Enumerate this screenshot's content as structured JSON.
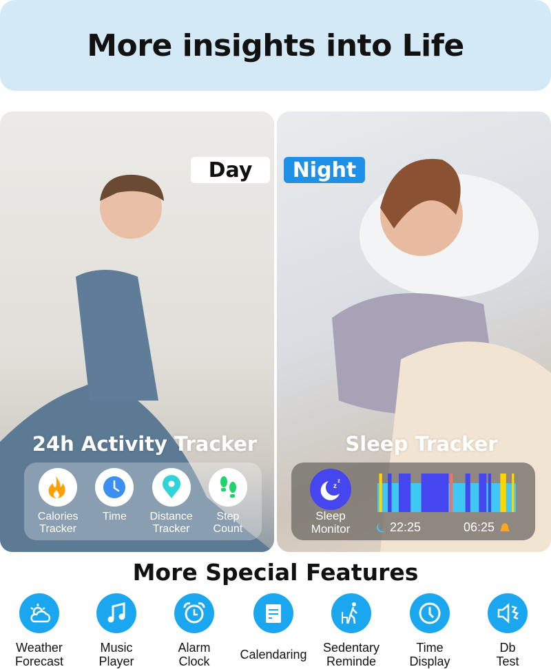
{
  "header": {
    "title": "More insights into Life"
  },
  "day": {
    "tag": "Day",
    "title": "24h Activity Tracker",
    "items": [
      {
        "label1": "Calories",
        "label2": "Tracker",
        "icon": "flame-icon",
        "color": "#ff9f00"
      },
      {
        "label1": "Time",
        "label2": "",
        "icon": "clock-icon",
        "color": "#3b8ff0"
      },
      {
        "label1": "Distance",
        "label2": "Tracker",
        "icon": "location-pin-icon",
        "color": "#2fd3d8"
      },
      {
        "label1": "Step",
        "label2": "Count",
        "icon": "footprints-icon",
        "color": "#1ed36a"
      }
    ]
  },
  "night": {
    "tag": "Night",
    "title": "Sleep Tracker",
    "monitor1": "Sleep",
    "monitor2": "Monitor",
    "start": "22:25",
    "end": "06:25",
    "colors": {
      "light": "#3fc8f5",
      "deep": "#4646f0",
      "awake": "#ffd600",
      "rem": "#f0706a"
    },
    "segments": [
      {
        "stage": "awake",
        "from": "22:31",
        "to": "22:41"
      },
      {
        "stage": "deep",
        "from": "23:01",
        "to": "23:14"
      },
      {
        "stage": "deep",
        "from": "23:39",
        "to": "00:20"
      },
      {
        "stage": "deep",
        "from": "00:57",
        "to": "02:32"
      },
      {
        "stage": "rem",
        "from": "02:36",
        "to": "02:46"
      },
      {
        "stage": "deep",
        "from": "03:30",
        "to": "03:47"
      },
      {
        "stage": "deep",
        "from": "04:17",
        "to": "04:43"
      },
      {
        "stage": "deep",
        "from": "04:49",
        "to": "04:59"
      },
      {
        "stage": "awake",
        "from": "05:31",
        "to": "05:51"
      },
      {
        "stage": "awake",
        "from": "06:11",
        "to": "06:19"
      }
    ]
  },
  "features": {
    "title": "More Special Features",
    "items": [
      {
        "l1": "Weather",
        "l2": "Forecast",
        "icon": "weather-icon"
      },
      {
        "l1": "Music",
        "l2": "Player",
        "icon": "music-note-icon"
      },
      {
        "l1": "Alarm",
        "l2": "Clock",
        "icon": "alarm-clock-icon"
      },
      {
        "l1": "Calendaring",
        "l2": "",
        "icon": "calendar-icon"
      },
      {
        "l1": "Sedentary",
        "l2": "Reminde",
        "icon": "sedentary-icon"
      },
      {
        "l1": "Time",
        "l2": "Display",
        "icon": "clock-icon"
      },
      {
        "l1": "Db",
        "l2": "Test",
        "icon": "speaker-icon"
      }
    ]
  }
}
